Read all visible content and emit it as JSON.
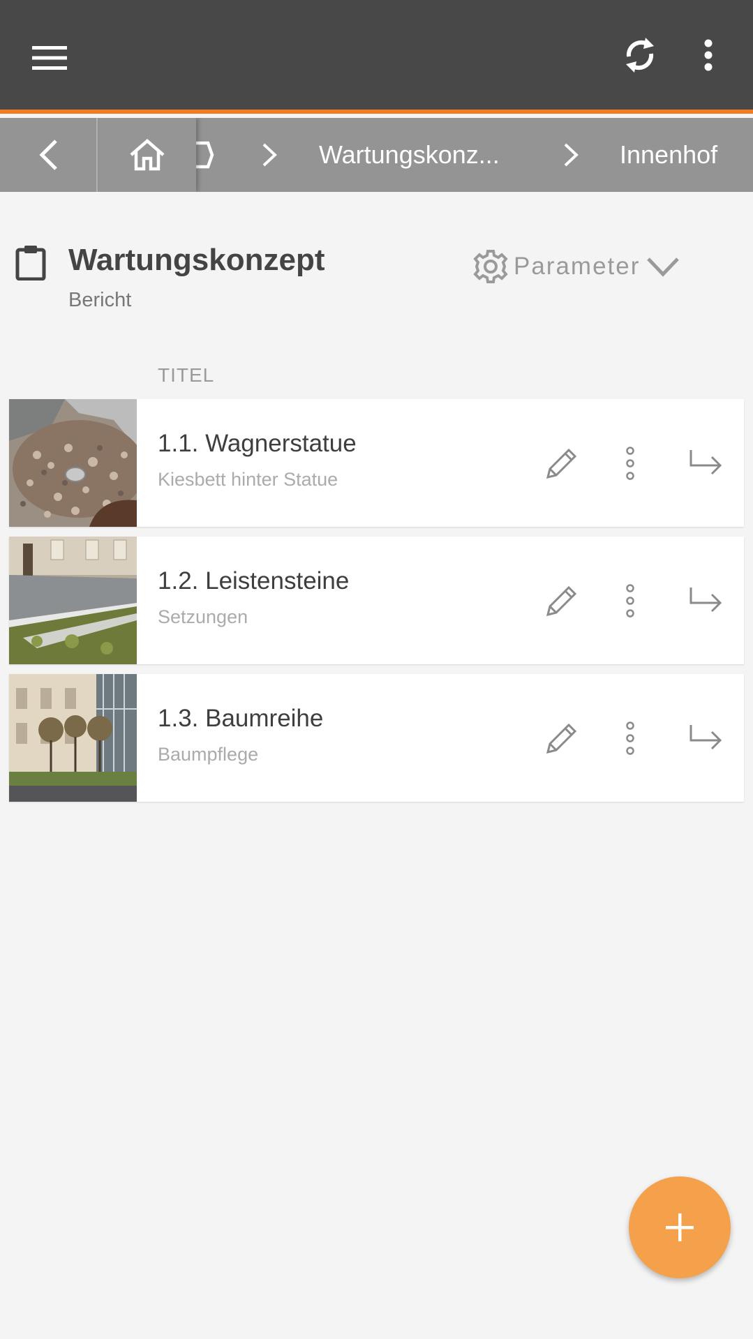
{
  "appbar": {
    "icons": [
      "menu-icon",
      "sync-icon",
      "more-vert-icon"
    ],
    "accent_color": "#f47c20"
  },
  "breadcrumb": {
    "items": [
      {
        "label": "Wartungskonz..."
      },
      {
        "label": "Innenhof"
      }
    ]
  },
  "report": {
    "title": "Wartungskonzept",
    "subtitle": "Bericht",
    "parameter_label": "Parameter"
  },
  "list": {
    "column_header": "TITEL",
    "items": [
      {
        "title": "1.1. Wagnerstatue",
        "subtitle": "Kiesbett hinter Statue",
        "thumb": "gravel-bed-photo"
      },
      {
        "title": "1.2. Leistensteine",
        "subtitle": "Setzungen",
        "thumb": "curbstones-photo"
      },
      {
        "title": "1.3. Baumreihe",
        "subtitle": "Baumpflege",
        "thumb": "tree-row-photo"
      }
    ]
  },
  "fab": {
    "icon": "plus-icon",
    "color": "#f5a04a"
  }
}
